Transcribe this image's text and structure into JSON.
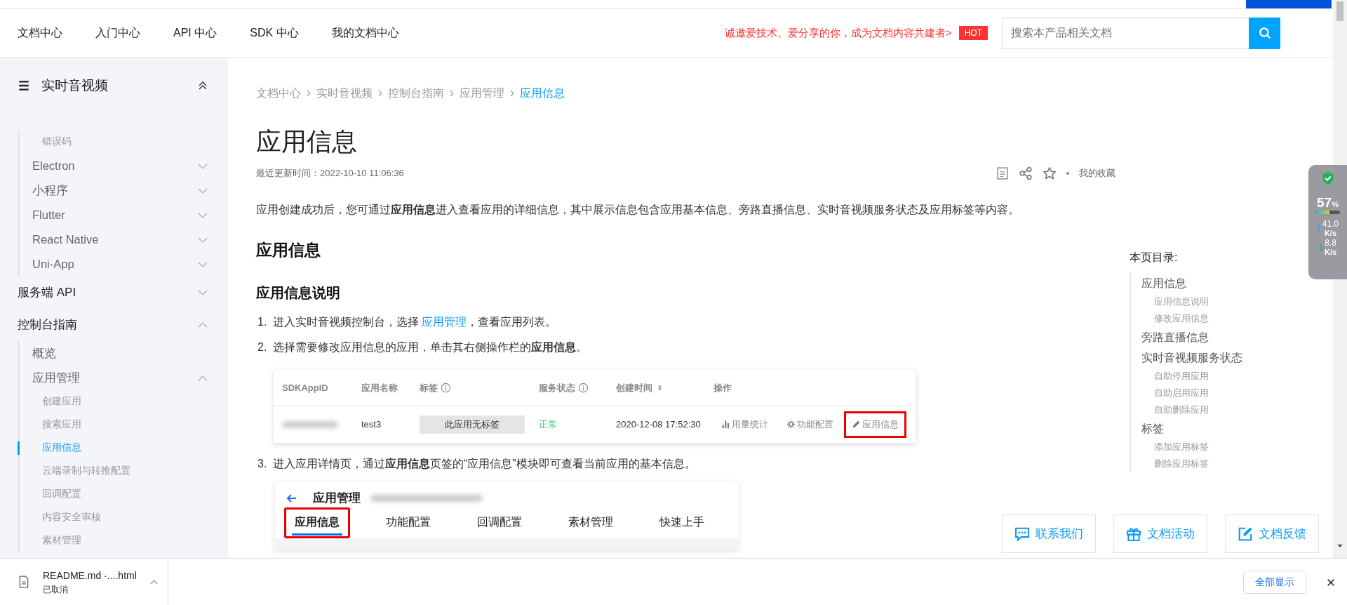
{
  "top_nav": {
    "links": [
      {
        "label": "文档中心"
      },
      {
        "label": "入门中心"
      },
      {
        "label": "API 中心"
      },
      {
        "label": "SDK 中心"
      },
      {
        "label": "我的文档中心"
      }
    ],
    "promo": "诚邀爱技术、爱分享的你，成为文档内容共建者>",
    "promo_badge": "HOT",
    "search": {
      "placeholder": "搜索本产品相关文档"
    }
  },
  "sidebar": {
    "title": "实时音视频",
    "expanded": true,
    "items": [
      {
        "children": [
          {
            "children": [
              {
                "label": "错误码",
                "selected": false
              }
            ]
          },
          {
            "label": "Electron",
            "expanded": false,
            "selected": false
          },
          {
            "label": "小程序",
            "expanded": false,
            "selected": false
          },
          {
            "label": "Flutter",
            "expanded": false,
            "selected": false
          },
          {
            "label": "React Native",
            "expanded": false,
            "selected": false
          },
          {
            "label": "Uni-App",
            "expanded": false,
            "selected": false
          }
        ]
      },
      {
        "label": "服务端 API",
        "expanded": false,
        "selected": false
      },
      {
        "label": "控制台指南",
        "expanded": true,
        "selected": false,
        "children": [
          {
            "label": "概览",
            "selected": false
          },
          {
            "label": "应用管理",
            "expanded": true,
            "selected": false,
            "children": [
              {
                "label": "创建应用",
                "selected": false
              },
              {
                "label": "搜索应用",
                "selected": false
              },
              {
                "label": "应用信息",
                "selected": true
              },
              {
                "label": "云端录制与转推配置",
                "selected": false
              },
              {
                "label": "回调配置",
                "selected": false
              },
              {
                "label": "内容安全审核",
                "selected": false
              },
              {
                "label": "素材管理",
                "selected": false
              }
            ]
          }
        ]
      }
    ]
  },
  "breadcrumb": [
    {
      "label": "文档中心",
      "selected": false
    },
    {
      "label": "实时音视频",
      "selected": false
    },
    {
      "label": "控制台指南",
      "selected": false
    },
    {
      "label": "应用管理",
      "selected": false
    },
    {
      "label": "应用信息",
      "selected": true
    }
  ],
  "article": {
    "title": "应用信息",
    "updated": "最近更新时间：2022-10-10 11:06:36",
    "favorite_label": "我的收藏",
    "intro": "应用创建成功后，您可通过**应用信息**进入查看应用的详细信息，其中展示信息包含应用基本信息、旁路直播信息、实时音视频服务状态及应用标签等内容。",
    "heading": "应用信息",
    "subheading": "应用信息说明",
    "steps": [
      {
        "number": "1.",
        "text": "进入实时音视频控制台，选择 ",
        "link": "应用管理",
        "text_after": "，查看应用列表。"
      },
      {
        "number": "2.",
        "text": "选择需要修改应用信息的应用，单击其右侧操作栏的**应用信息**。",
        "table_figure": {
          "columns": [
            {
              "label": "SDKAppID",
              "kind": "plain"
            },
            {
              "label": "应用名称",
              "kind": "plain"
            },
            {
              "label": "标签",
              "kind": "info"
            },
            {
              "label": "服务状态",
              "kind": "info"
            },
            {
              "label": "创建时间",
              "kind": "sort"
            },
            {
              "label": "操作",
              "kind": "plain"
            }
          ],
          "row": {
            "name": "test3",
            "tag": "此应用无标签",
            "status": "正常",
            "created": "2020-12-08 17:52:30",
            "actions": [
              {
                "label": "用量统计",
                "kind": "chart",
                "highlighted": false
              },
              {
                "label": "功能配置",
                "kind": "gear",
                "highlighted": false
              },
              {
                "label": "应用信息",
                "kind": "edit",
                "highlighted": true
              }
            ]
          }
        }
      },
      {
        "number": "3.",
        "text": "进入应用详情页，通过**应用信息**页签的“应用信息”模块即可查看当前应用的基本信息。",
        "detail_figure": {
          "title": "应用管理",
          "tabs": [
            {
              "label": "应用信息",
              "selected": true,
              "highlighted": true
            },
            {
              "label": "功能配置",
              "selected": false,
              "highlighted": false
            },
            {
              "label": "回调配置",
              "selected": false,
              "highlighted": false
            },
            {
              "label": "素材管理",
              "selected": false,
              "highlighted": false
            },
            {
              "label": "快速上手",
              "selected": false,
              "highlighted": false
            }
          ]
        }
      }
    ]
  },
  "toc": {
    "title": "本页目录:",
    "items": [
      {
        "label": "应用信息",
        "children": [
          {
            "label": "应用信息说明"
          },
          {
            "label": "修改应用信息"
          }
        ]
      },
      {
        "label": "旁路直播信息"
      },
      {
        "label": "实时音视频服务状态",
        "children": [
          {
            "label": "自助停用应用"
          },
          {
            "label": "自助启用应用"
          },
          {
            "label": "自助删除应用"
          }
        ]
      },
      {
        "label": "标签",
        "children": [
          {
            "label": "添加应用标签"
          },
          {
            "label": "删除应用标签"
          }
        ]
      }
    ]
  },
  "float_buttons": [
    {
      "label": "联系我们",
      "kind": "chat"
    },
    {
      "label": "文档活动",
      "kind": "gift"
    },
    {
      "label": "文档反馈",
      "kind": "edit"
    }
  ],
  "monitor": {
    "percent": "57",
    "unit": "%",
    "level": 0.57,
    "upload": "41.0",
    "upload_unit": "K/s",
    "download": "8.8",
    "download_unit": "K/s"
  },
  "download_bar": {
    "file": "README.md ·....html",
    "status": "已取消",
    "show_all": "全部显示"
  }
}
